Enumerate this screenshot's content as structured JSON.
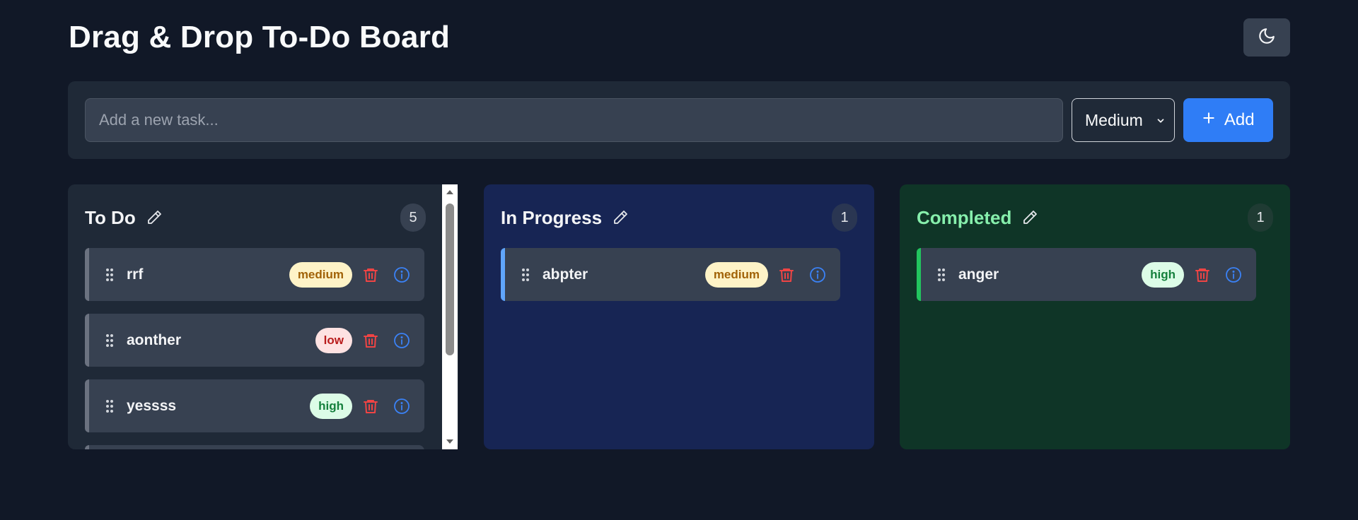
{
  "header": {
    "title": "Drag & Drop To-Do Board",
    "theme_toggle_icon": "moon-icon"
  },
  "add_task": {
    "placeholder": "Add a new task...",
    "value": "",
    "priority_selected": "Medium",
    "add_label": "Add",
    "add_icon": "plus-icon"
  },
  "colors": {
    "background": "#111827",
    "panel": "#1f2937",
    "accent_blue": "#2f7df6",
    "in_progress_bg": "#172554",
    "completed_bg": "#0f3527",
    "completed_title": "#86efac",
    "trash": "#ef4444",
    "info": "#3b82f6"
  },
  "columns": {
    "todo": {
      "title": "To Do",
      "count": "5",
      "cards": [
        {
          "title": "rrf",
          "priority": "medium"
        },
        {
          "title": "aonther",
          "priority": "low"
        },
        {
          "title": "yessss",
          "priority": "high"
        }
      ]
    },
    "in_progress": {
      "title": "In Progress",
      "count": "1",
      "cards": [
        {
          "title": "abpter",
          "priority": "medium"
        }
      ]
    },
    "completed": {
      "title": "Completed",
      "count": "1",
      "cards": [
        {
          "title": "anger",
          "priority": "high"
        }
      ]
    }
  }
}
